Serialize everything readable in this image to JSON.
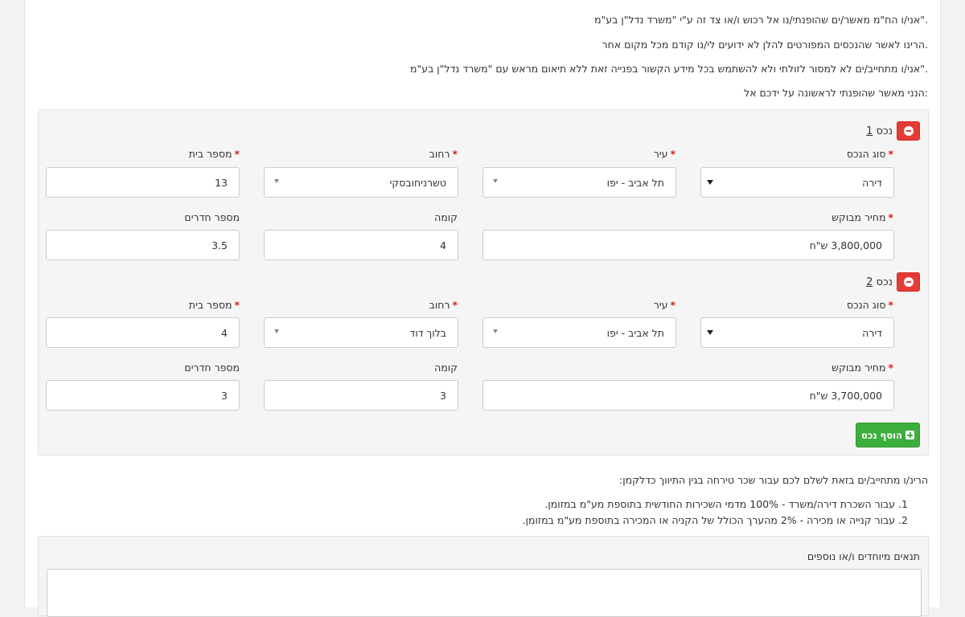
{
  "intro": {
    "line1": "אני/ו הח\"מ מאשר/ים שהופנתי/נו אל רכוש ו/או צד זה ע\"י \"משרד נדל\"ן בע\"מ\".",
    "line2": "הרינו לאשר שהנכסים המפורטים להלן לא ידועים לי/נו קודם מכל מקום אחר.",
    "line3": "אני/ו מתחייב/ים לא למסור לזולתי ולא להשתמש בכל מידע הקשור בפנייה זאת ללא תיאום מראש עם \"משרד נדל\"ן בע\"מ\".",
    "line4": "הנני מאשר שהופנתי לראשונה על ידכם אל:"
  },
  "labels": {
    "property_type": "סוג הנכס",
    "city": "עיר",
    "street": "רחוב",
    "house_number": "מספר בית",
    "asking_price": "מחיר מבוקש",
    "floor": "קומה",
    "rooms": "מספר חדרים",
    "add_property": "הוסף נכס",
    "required_mark": "*"
  },
  "properties": [
    {
      "title": "נכס",
      "number": "1",
      "property_type": "דירה",
      "city": "תל אביב - יפו",
      "street": "טשרניחובסקי",
      "house_number": "13",
      "asking_price": "3,800,000 ש\"ח",
      "floor": "4",
      "rooms": "3.5"
    },
    {
      "title": "נכס",
      "number": "2",
      "property_type": "דירה",
      "city": "תל אביב - יפו",
      "street": "בלוך דוד",
      "house_number": "4",
      "asking_price": "3,700,000 ש\"ח",
      "floor": "3",
      "rooms": "3"
    }
  ],
  "commission": {
    "heading": "הרינ/ו מתחייב/ים בזאת לשלם לכם עבור שכר טירחה בגין התיווך כדלקמן:",
    "item1": "1. עבור השכרת דירה/משרד -  100% מדמי השכירות החודשית בתוספת מע\"מ במזומן.",
    "item2": "2. עבור קנייה או מכירה -  2% מהערך הכולל של הקניה או המכירה בתוספת מע\"מ במזומן."
  },
  "special_terms": {
    "label": "תנאים מיוחדים ו/או נוספים",
    "value": ""
  }
}
